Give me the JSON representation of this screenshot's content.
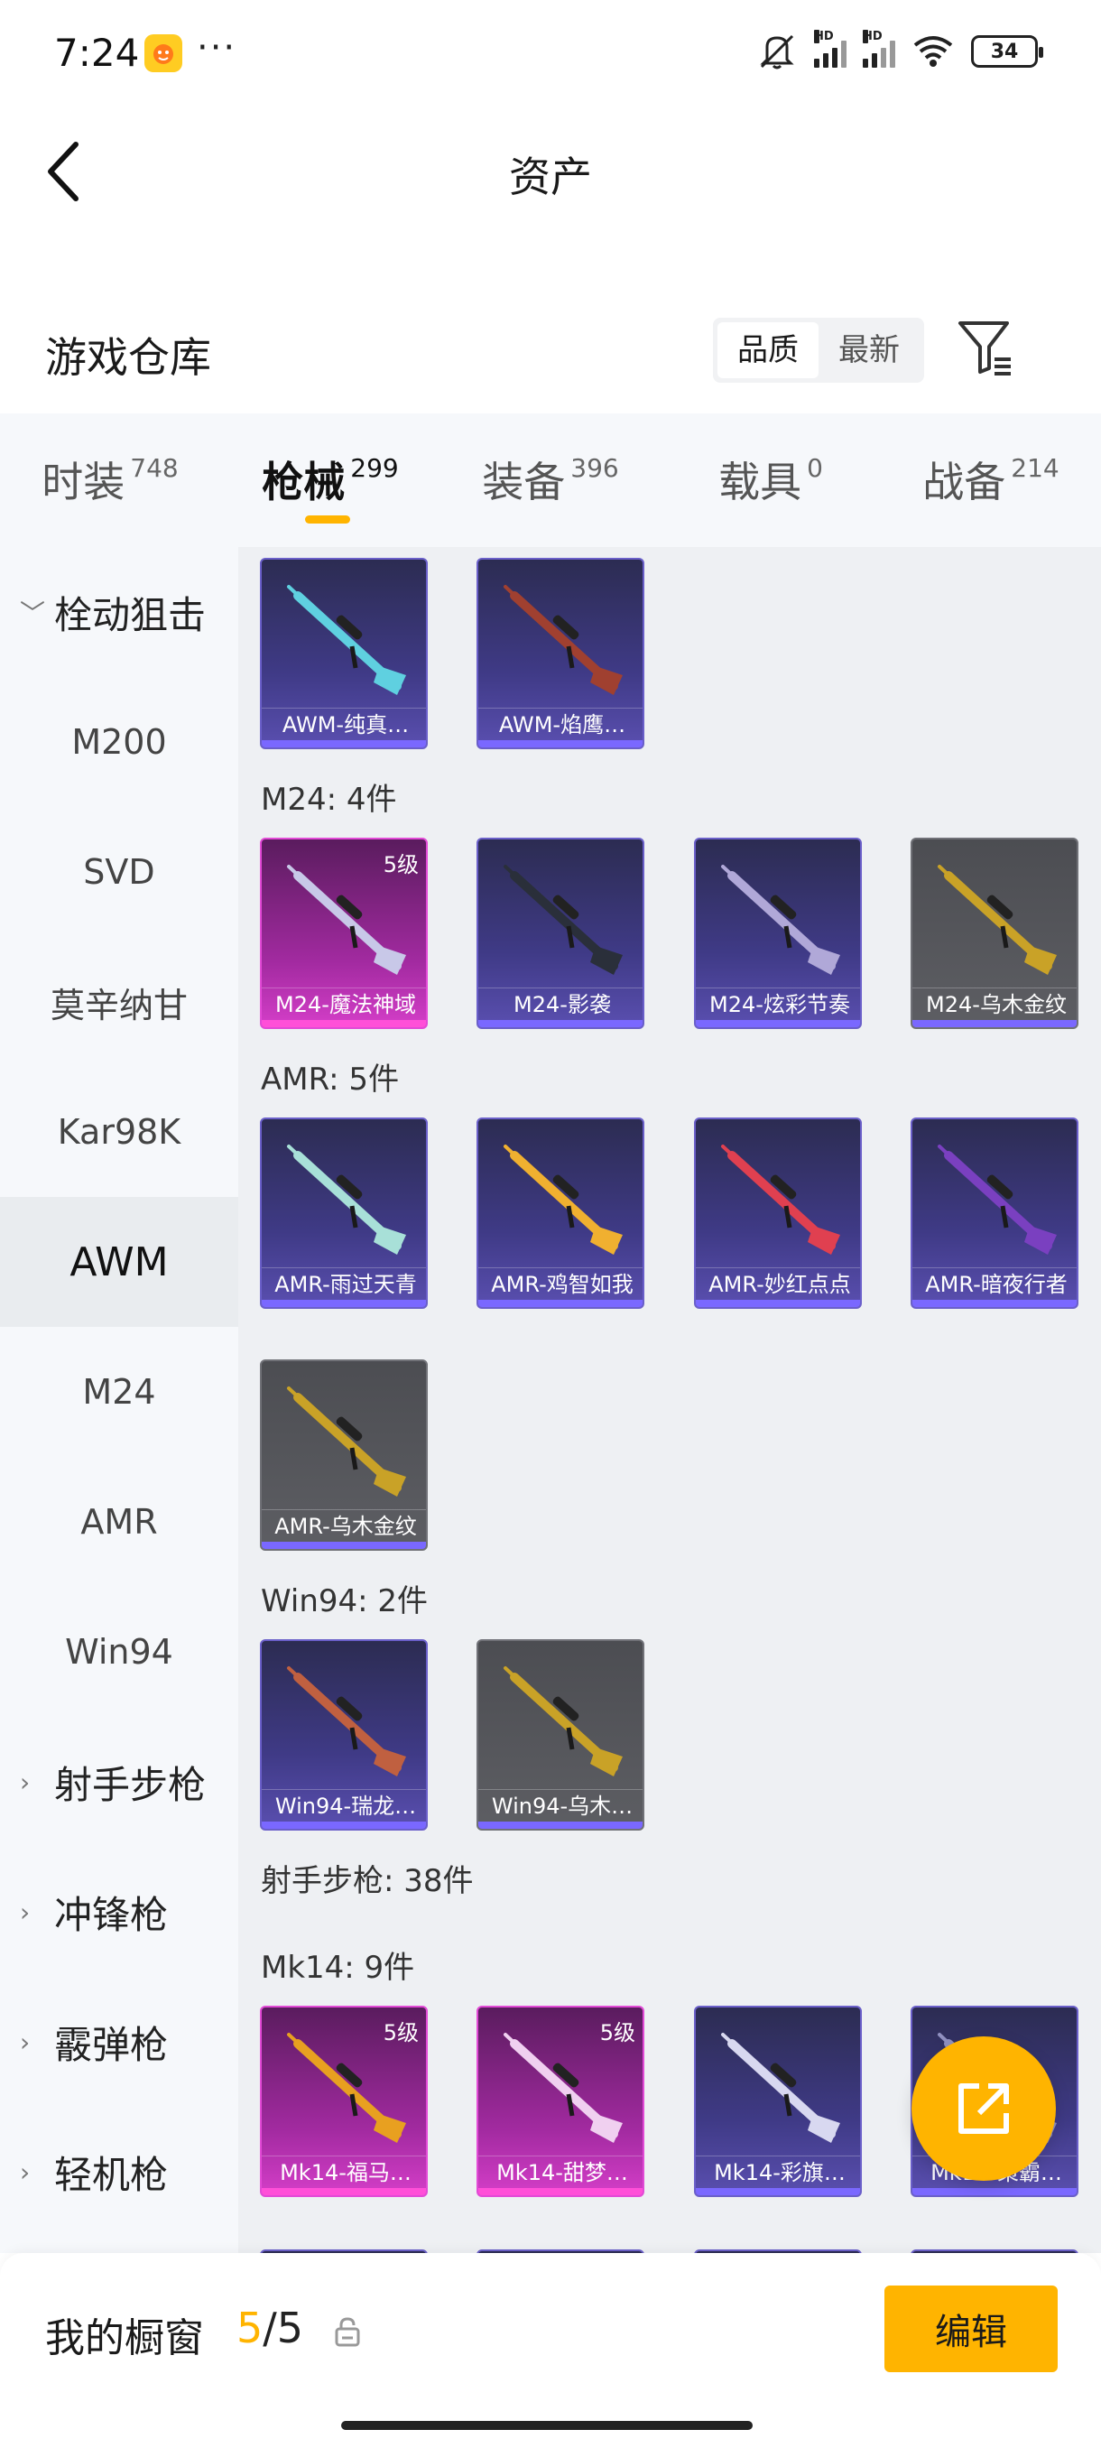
{
  "status": {
    "time": "7:24",
    "app_icon": "game-app-icon",
    "more": "···",
    "battery": "34",
    "signal_labels": [
      "HD",
      "HD"
    ]
  },
  "header": {
    "title": "资产",
    "back_icon": "chevron-left-icon"
  },
  "section": {
    "title": "游戏仓库",
    "sort_options": [
      "品质",
      "最新"
    ],
    "sort_selected": "品质",
    "filter_icon": "filter-icon"
  },
  "tabs": [
    {
      "label": "时装",
      "count": "748"
    },
    {
      "label": "枪械",
      "count": "299",
      "active": true
    },
    {
      "label": "装备",
      "count": "396"
    },
    {
      "label": "载具",
      "count": "0"
    },
    {
      "label": "战备",
      "count": "214"
    }
  ],
  "sidebar": {
    "items": [
      {
        "label": "栓动狙击",
        "parent": true,
        "expanded": true
      },
      {
        "label": "M200"
      },
      {
        "label": "SVD"
      },
      {
        "label": "莫辛纳甘"
      },
      {
        "label": "Kar98K"
      },
      {
        "label": "AWM",
        "selected": true
      },
      {
        "label": "M24"
      },
      {
        "label": "AMR"
      },
      {
        "label": "Win94"
      },
      {
        "label": "射手步枪",
        "parent": true
      },
      {
        "label": "冲锋枪",
        "parent": true
      },
      {
        "label": "霰弹枪",
        "parent": true
      },
      {
        "label": "轻机枪",
        "parent": true
      }
    ]
  },
  "content": {
    "groups": [
      {
        "label": "",
        "cards": [
          {
            "name": "AWM-纯真…",
            "rarity": "blue",
            "gun_color": "#5fd0e0"
          },
          {
            "name": "AWM-焰鹰…",
            "rarity": "blue",
            "gun_color": "#a04030"
          }
        ]
      },
      {
        "label": "M24: 4件",
        "cards": [
          {
            "name": "M24-魔法神域",
            "rarity": "pink",
            "level": "5级",
            "gun_color": "#c8c8e8"
          },
          {
            "name": "M24-影袭",
            "rarity": "blue",
            "gun_color": "#2a2f3a"
          },
          {
            "name": "M24-炫彩节奏",
            "rarity": "blue",
            "gun_color": "#b0a8d8"
          },
          {
            "name": "M24-乌木金纹",
            "rarity": "gray",
            "gun_color": "#c9a227"
          }
        ]
      },
      {
        "label": "AMR: 5件",
        "cards": [
          {
            "name": "AMR-雨过天青",
            "rarity": "blue",
            "gun_color": "#a8e0d8"
          },
          {
            "name": "AMR-鸡智如我",
            "rarity": "blue",
            "gun_color": "#f0b030"
          },
          {
            "name": "AMR-妙红点点",
            "rarity": "blue",
            "gun_color": "#e04050"
          },
          {
            "name": "AMR-暗夜行者",
            "rarity": "blue",
            "gun_color": "#7a40c0"
          },
          {
            "name": "AMR-乌木金纹",
            "rarity": "gray",
            "gun_color": "#c9a227"
          }
        ]
      },
      {
        "label": "Win94: 2件",
        "cards": [
          {
            "name": "Win94-瑞龙…",
            "rarity": "blue",
            "gun_color": "#c06040"
          },
          {
            "name": "Win94-乌木…",
            "rarity": "gray",
            "gun_color": "#c9a227"
          }
        ]
      },
      {
        "label": "射手步枪: 38件",
        "cards": []
      },
      {
        "label": "Mk14: 9件",
        "cards": [
          {
            "name": "Mk14-福马…",
            "rarity": "pink",
            "level": "5级",
            "gun_color": "#e8a020"
          },
          {
            "name": "Mk14-甜梦…",
            "rarity": "pink",
            "level": "5级",
            "gun_color": "#f0d0f0"
          },
          {
            "name": "Mk14-彩旗…",
            "rarity": "blue",
            "gun_color": "#d8d8f0"
          },
          {
            "name": "Mk14-策霸…",
            "rarity": "blue",
            "gun_color": "#9090c0"
          }
        ]
      }
    ]
  },
  "fab": {
    "icon": "share-external-icon"
  },
  "bottom": {
    "title": "我的橱窗",
    "count_current": "5",
    "count_sep": "/",
    "count_max": "5",
    "lock_icon": "lock-icon",
    "edit_label": "编辑"
  },
  "colors": {
    "accent": "#ffb400",
    "blue_card": "#3f3a86",
    "pink_card": "#a22aa0",
    "gray_card": "#5d5e63"
  }
}
